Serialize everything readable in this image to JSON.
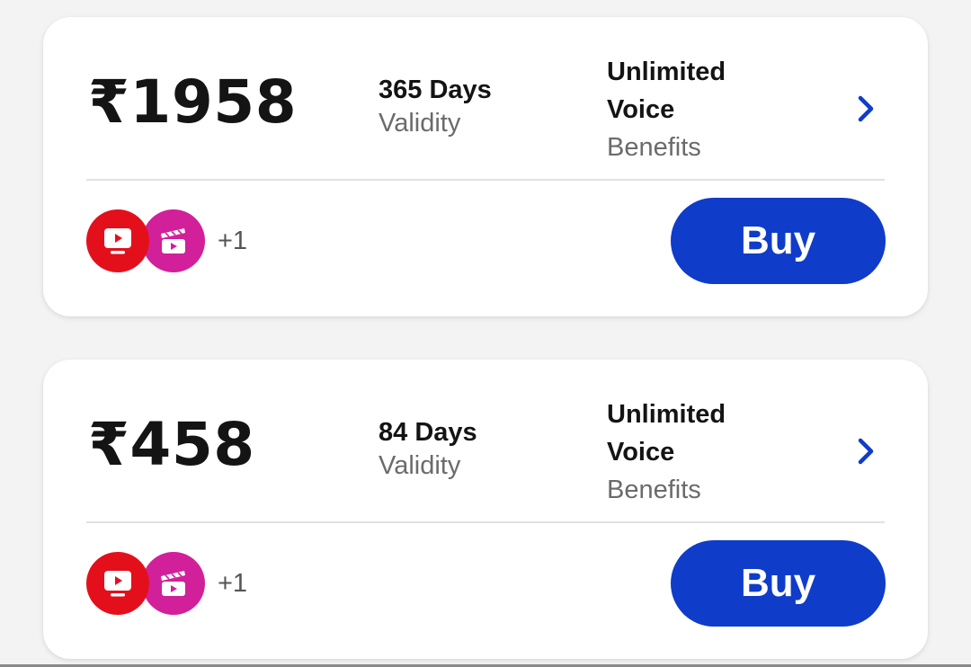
{
  "plans": [
    {
      "price": "₹1958",
      "validity_days": "365 Days",
      "validity_label": "Validity",
      "benefit_line1": "Unlimited",
      "benefit_line2": "Voice",
      "benefit_label": "Benefits",
      "more_apps": "+1",
      "buy_label": "Buy",
      "apps": [
        "tv-app-icon",
        "cinema-app-icon"
      ]
    },
    {
      "price": "₹458",
      "validity_days": "84 Days",
      "validity_label": "Validity",
      "benefit_line1": "Unlimited",
      "benefit_line2": "Voice",
      "benefit_label": "Benefits",
      "more_apps": "+1",
      "buy_label": "Buy",
      "apps": [
        "tv-app-icon",
        "cinema-app-icon"
      ]
    }
  ],
  "colors": {
    "accent": "#0f3cc9",
    "tv_app": "#e3101c",
    "cinema_app": "#d1209a",
    "background": "#f3f3f3"
  }
}
